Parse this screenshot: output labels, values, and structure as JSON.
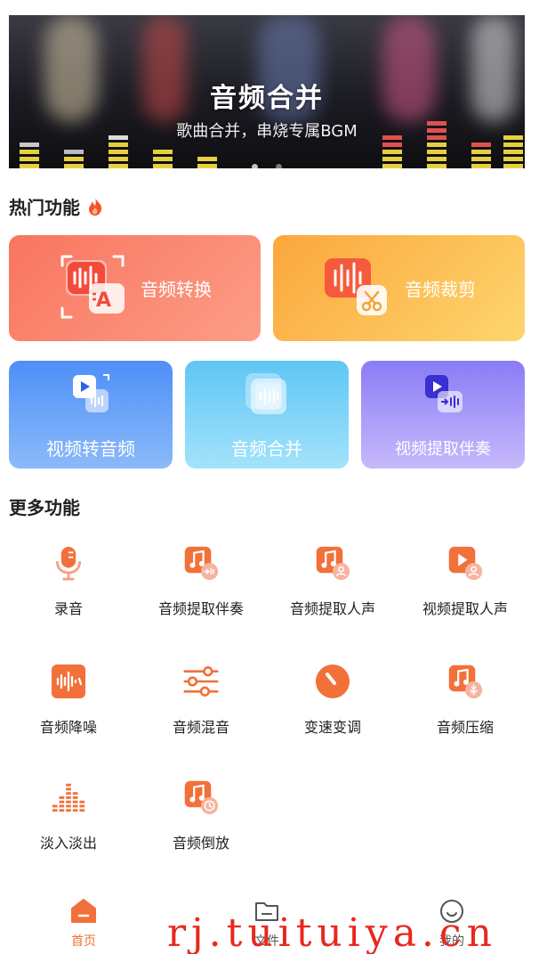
{
  "banner": {
    "title": "音频合并",
    "subtitle": "歌曲合并，串烧专属BGM",
    "slides": 2,
    "active_slide": 1
  },
  "hot": {
    "title": "热门功能",
    "icon": "flame-icon",
    "cards": [
      {
        "label": "音频转换",
        "icon": "audio-convert-icon"
      },
      {
        "label": "音频裁剪",
        "icon": "audio-cut-icon"
      },
      {
        "label": "视频转音频",
        "icon": "video-to-audio-icon"
      },
      {
        "label": "音频合并",
        "icon": "audio-merge-icon"
      },
      {
        "label": "视频提取伴奏",
        "icon": "video-extract-accompaniment-icon"
      }
    ]
  },
  "more": {
    "title": "更多功能",
    "items": [
      {
        "label": "录音",
        "icon": "microphone-icon"
      },
      {
        "label": "音频提取伴奏",
        "icon": "music-note-extract-icon"
      },
      {
        "label": "音频提取人声",
        "icon": "music-note-voice-icon"
      },
      {
        "label": "视频提取人声",
        "icon": "video-voice-icon"
      },
      {
        "label": "音频降噪",
        "icon": "waveform-icon"
      },
      {
        "label": "音频混音",
        "icon": "mixer-sliders-icon"
      },
      {
        "label": "变速变调",
        "icon": "speedometer-icon"
      },
      {
        "label": "音频压缩",
        "icon": "music-note-compress-icon"
      },
      {
        "label": "淡入淡出",
        "icon": "fade-bars-icon"
      },
      {
        "label": "音频倒放",
        "icon": "music-note-reverse-icon"
      }
    ]
  },
  "nav": {
    "items": [
      {
        "label": "首页",
        "icon": "home-icon",
        "active": true
      },
      {
        "label": "文件",
        "icon": "folder-icon",
        "active": false
      },
      {
        "label": "我的",
        "icon": "smiley-icon",
        "active": false
      }
    ]
  },
  "watermark": "rj.tuituiya.cn",
  "colors": {
    "accent": "#f2703a",
    "card_convert": "#f9755f",
    "card_cut": "#fca73c",
    "card_video": "#4e8ff8",
    "card_merge": "#5ec6f6",
    "card_extract": "#8a7cf5"
  }
}
